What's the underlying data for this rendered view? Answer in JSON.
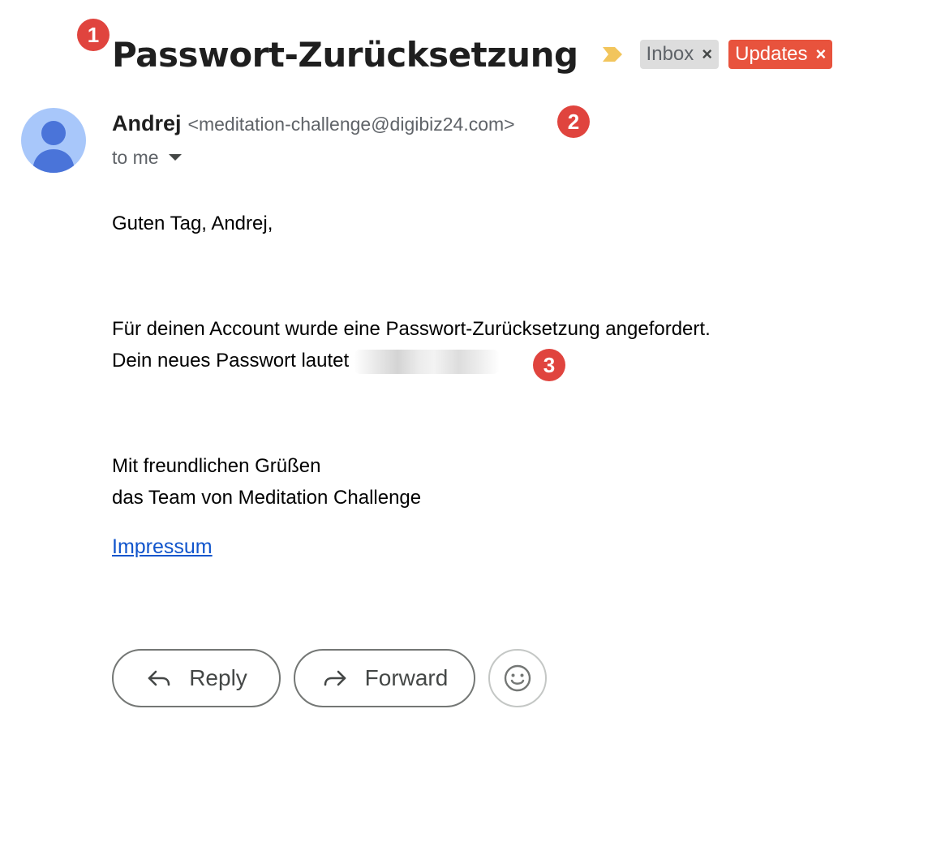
{
  "subject": "Passwort-Zurücksetzung",
  "labels": [
    {
      "name": "Inbox",
      "remove": "×",
      "color": "#dddddd"
    },
    {
      "name": "Updates",
      "remove": "×",
      "color": "#e8533d"
    }
  ],
  "importance_icon": "importance-marker-icon",
  "sender": {
    "name": "Andrej",
    "email": "<meditation-challenge@digibiz24.com>",
    "avatar_icon": "person-avatar-icon"
  },
  "recipient": {
    "label": "to me"
  },
  "message": {
    "greeting": "Guten Tag, Andrej,",
    "line1": "Für deinen Account wurde eine Passwort-Zurücksetzung angefordert.",
    "line2": "Dein neues Passwort lautet",
    "closing1": "Mit freundlichen Grüßen",
    "closing2": "das Team von Meditation Challenge",
    "link": "Impressum"
  },
  "actions": {
    "reply": "Reply",
    "forward": "Forward",
    "emoji_icon": "emoji-reaction-icon"
  },
  "annotations": [
    "1",
    "2",
    "3"
  ],
  "colors": {
    "badge": "#e0443e",
    "link": "#1155cc",
    "avatar_bg": "#a8c7fa",
    "avatar_fg": "#4a74d9",
    "importance": "#f2c55c"
  }
}
